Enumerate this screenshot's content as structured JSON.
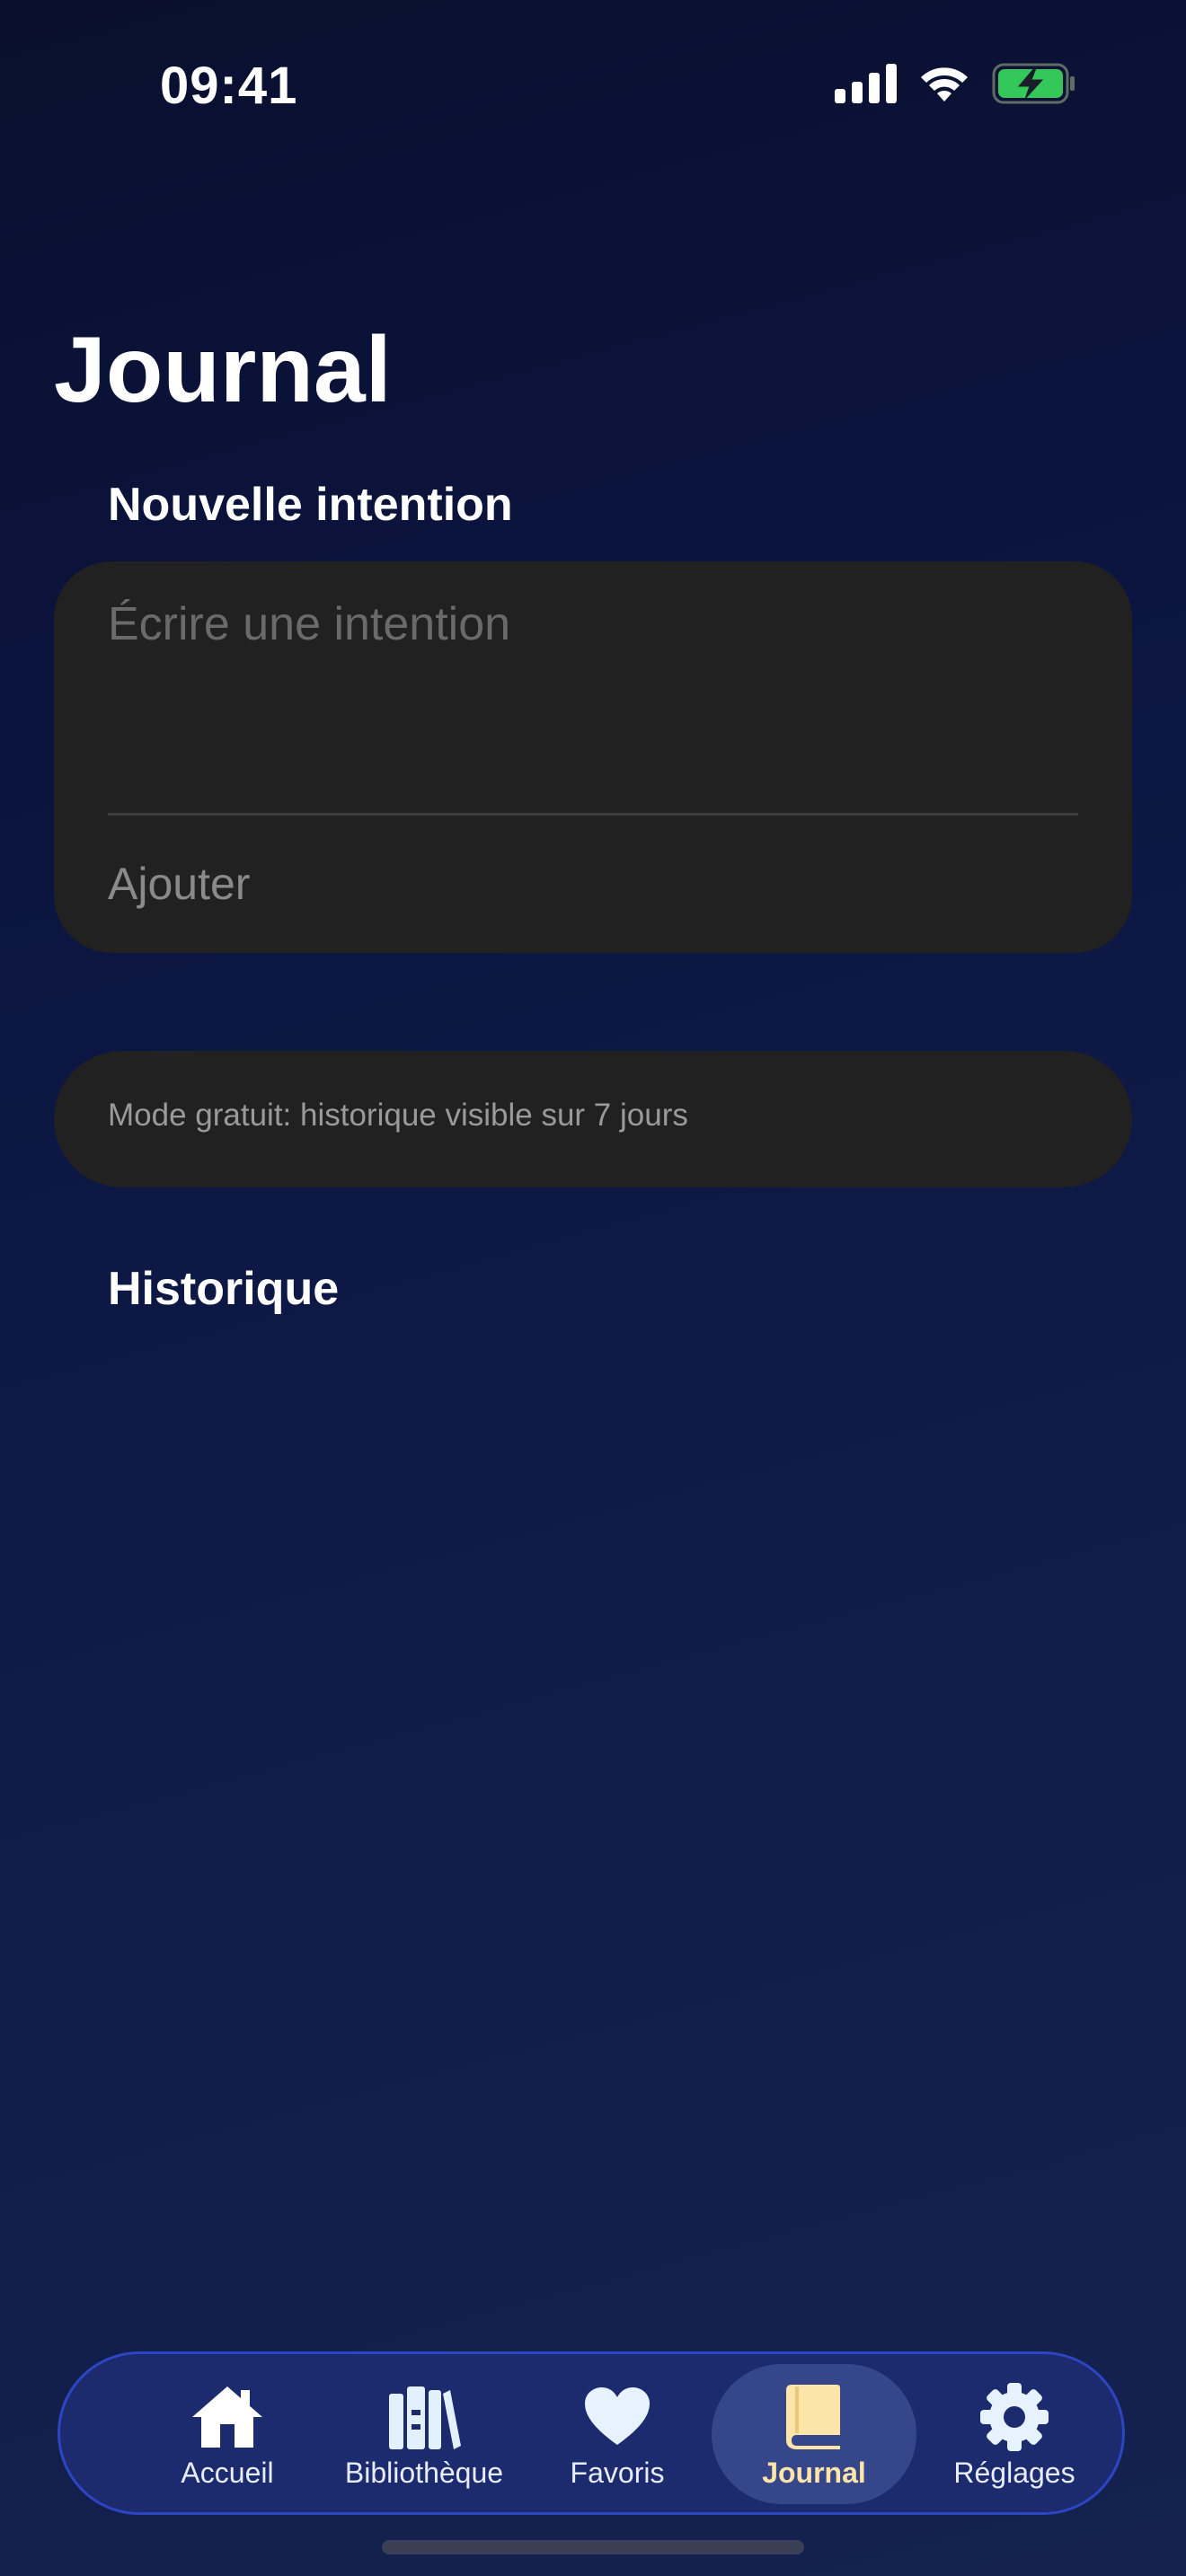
{
  "status_bar": {
    "time": "09:41"
  },
  "page": {
    "title": "Journal"
  },
  "new_intention": {
    "section_label": "Nouvelle intention",
    "input_value": "",
    "input_placeholder": "Écrire une intention",
    "add_label": "Ajouter"
  },
  "info": {
    "text": "Mode gratuit: historique visible sur 7 jours"
  },
  "history": {
    "section_label": "Historique",
    "items": []
  },
  "tab_bar": {
    "tabs": [
      {
        "label": "Accueil",
        "icon": "house-icon",
        "active": false
      },
      {
        "label": "Bibliothèque",
        "icon": "books-icon",
        "active": false
      },
      {
        "label": "Favoris",
        "icon": "heart-icon",
        "active": false
      },
      {
        "label": "Journal",
        "icon": "book-icon",
        "active": true
      },
      {
        "label": "Réglages",
        "icon": "gear-icon",
        "active": false
      }
    ]
  },
  "colors": {
    "accent_active": "#fde4a8",
    "battery_charge": "#34c759",
    "tab_bar_border": "#2c45c2"
  }
}
